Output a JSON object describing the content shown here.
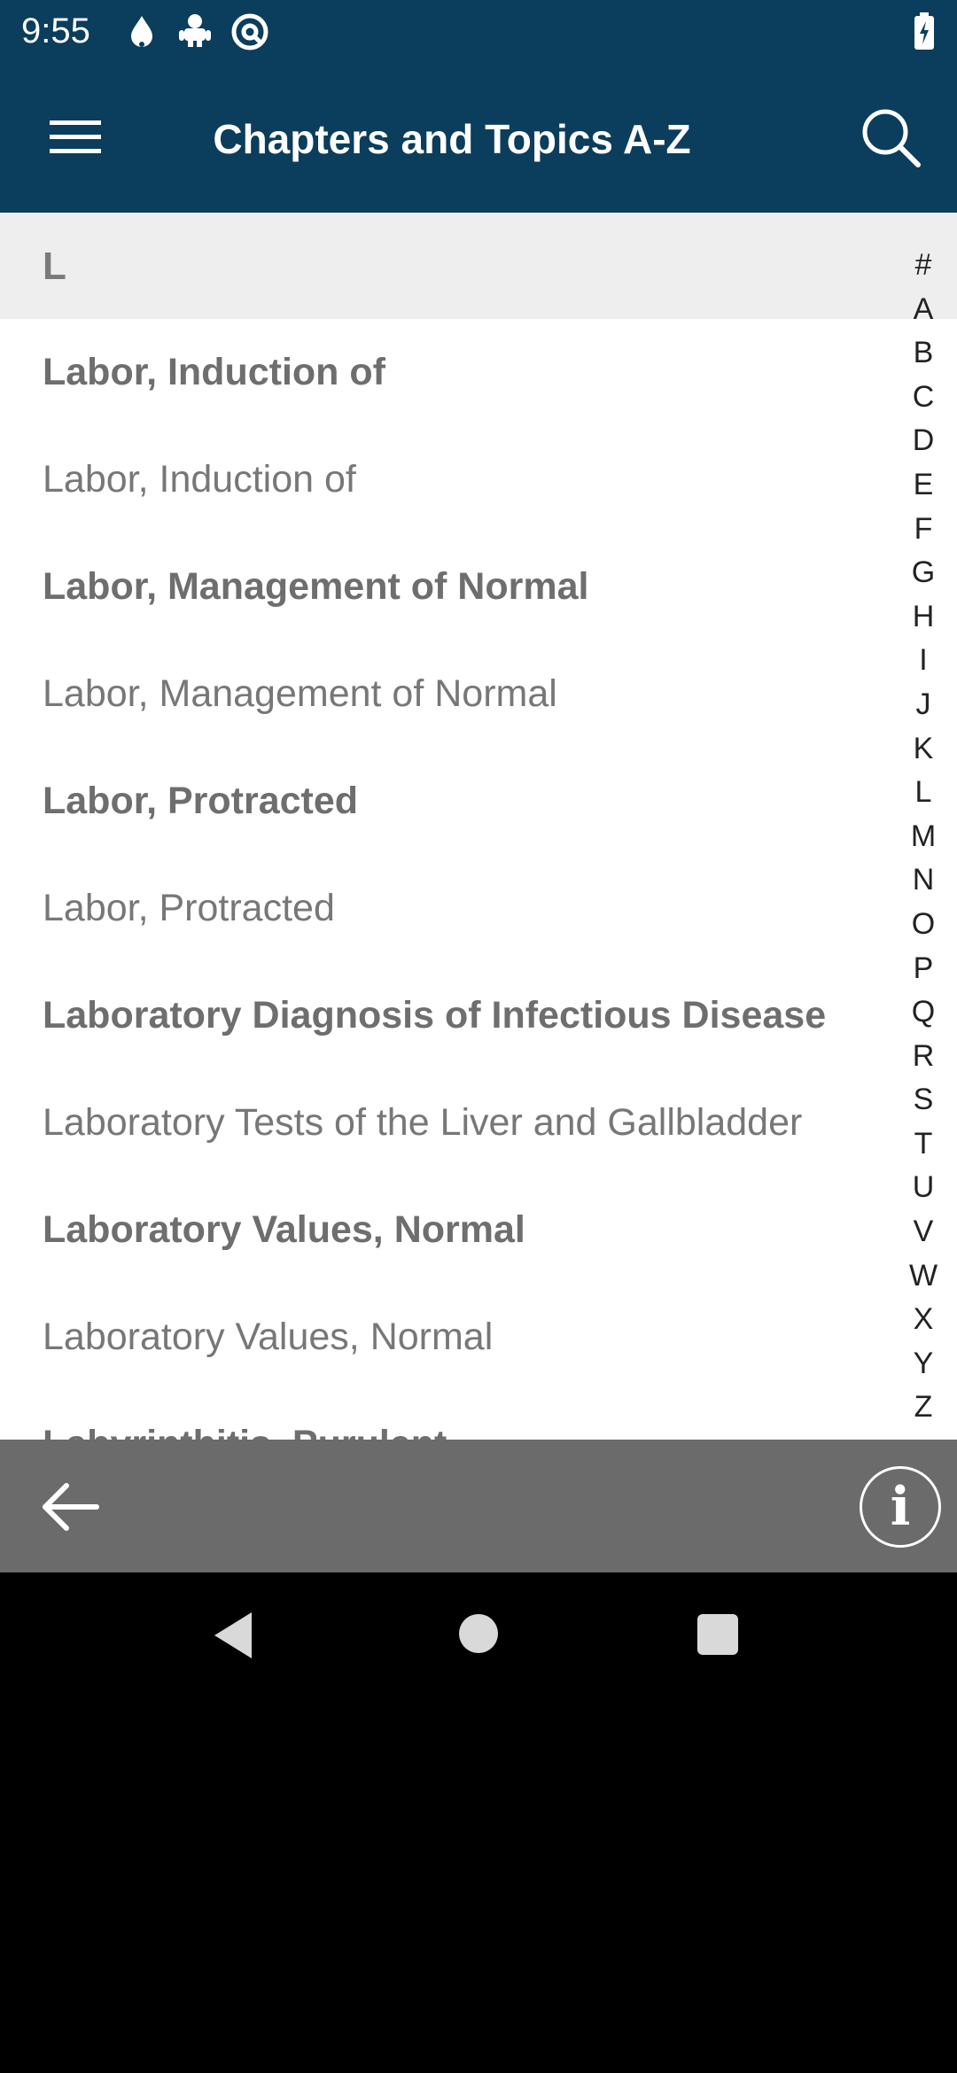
{
  "status_bar": {
    "time": "9:55",
    "icons": [
      "drop-notification-icon",
      "android-notification-icon",
      "vpn-at-icon"
    ],
    "battery": "battery-charging-icon"
  },
  "app_bar": {
    "title": "Chapters and Topics A-Z",
    "menu_icon": "hamburger-menu-icon",
    "search_icon": "search-icon",
    "background": "#0b3d5c"
  },
  "section": {
    "letter": "L"
  },
  "topics": [
    {
      "label": "Labor, Induction of",
      "bold": true
    },
    {
      "label": "Labor, Induction of",
      "bold": false
    },
    {
      "label": "Labor, Management of Normal",
      "bold": true
    },
    {
      "label": "Labor, Management of Normal",
      "bold": false
    },
    {
      "label": "Labor, Protracted",
      "bold": true
    },
    {
      "label": "Labor, Protracted",
      "bold": false
    },
    {
      "label": "Laboratory Diagnosis of Infectious Disease",
      "bold": true
    },
    {
      "label": "Laboratory Tests of the Liver and Gallbladder",
      "bold": false
    },
    {
      "label": "Laboratory Values, Normal",
      "bold": true
    },
    {
      "label": "Laboratory Values, Normal",
      "bold": false
    },
    {
      "label": "Labyrinthitis, Purulent",
      "bold": true
    }
  ],
  "az_index": [
    "#",
    "A",
    "B",
    "C",
    "D",
    "E",
    "F",
    "G",
    "H",
    "I",
    "J",
    "K",
    "L",
    "M",
    "N",
    "O",
    "P",
    "Q",
    "R",
    "S",
    "T",
    "U",
    "V",
    "W",
    "X",
    "Y",
    "Z"
  ],
  "bottom_bar": {
    "back_icon": "arrow-left-icon",
    "info_icon": "info-icon",
    "info_glyph": "i",
    "background": "#6b6b6b"
  },
  "nav_bar": {
    "back": "nav-back-icon",
    "home": "nav-home-icon",
    "recents": "nav-recents-icon"
  }
}
